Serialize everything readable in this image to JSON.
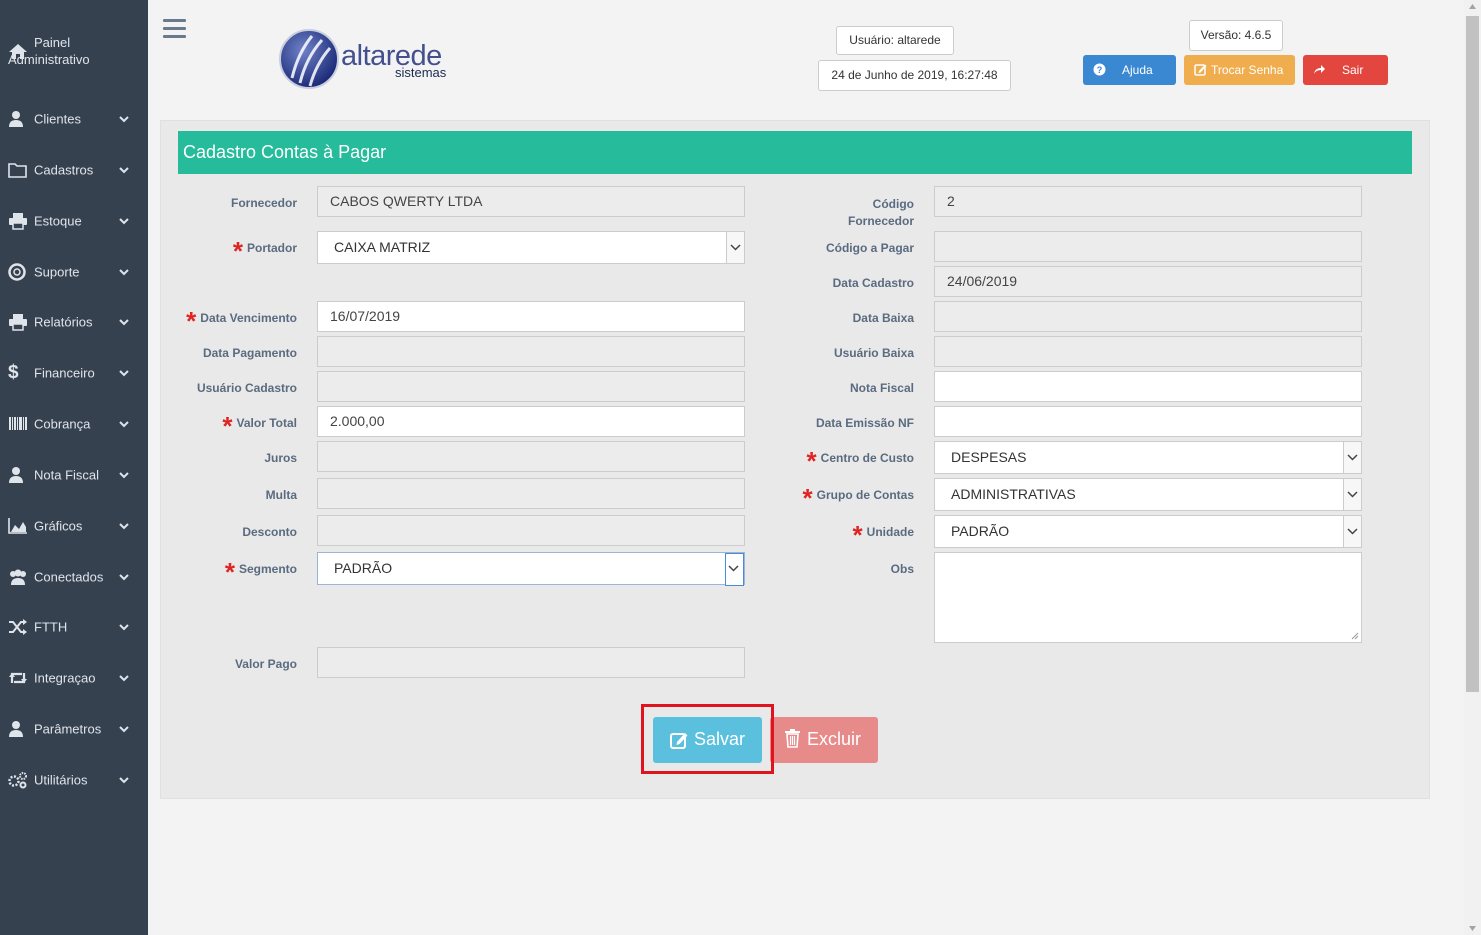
{
  "sidebar": {
    "items": [
      {
        "label": "Painel Administrativo",
        "icon": "home-icon"
      },
      {
        "label": "Clientes",
        "icon": "user-icon"
      },
      {
        "label": "Cadastros",
        "icon": "folder-icon"
      },
      {
        "label": "Estoque",
        "icon": "print-icon"
      },
      {
        "label": "Suporte",
        "icon": "lifebuoy-icon"
      },
      {
        "label": "Relatórios",
        "icon": "print-icon"
      },
      {
        "label": "Financeiro",
        "icon": "dollar-icon"
      },
      {
        "label": "Cobrança",
        "icon": "barcode-icon"
      },
      {
        "label": "Nota Fiscal",
        "icon": "user-icon"
      },
      {
        "label": "Gráficos",
        "icon": "area-chart-icon"
      },
      {
        "label": "Conectados",
        "icon": "users-icon"
      },
      {
        "label": "FTTH",
        "icon": "random-icon"
      },
      {
        "label": "Integraçao",
        "icon": "retweet-icon"
      },
      {
        "label": "Parâmetros",
        "icon": "user-icon"
      },
      {
        "label": "Utilitários",
        "icon": "cogs-icon"
      }
    ]
  },
  "header": {
    "logo_text": "altarede",
    "logo_sub": "sistemas",
    "user": "Usuário: altarede",
    "datetime": "24 de Junho de 2019, 16:27:48",
    "version": "Versão: 4.6.5",
    "help_label": "Ajuda",
    "change_password_label": "Trocar Senha",
    "exit_label": "Sair"
  },
  "form": {
    "title": "Cadastro Contas à Pagar",
    "left": {
      "fornecedor": {
        "label": "Fornecedor",
        "value": "CABOS QWERTY LTDA"
      },
      "portador": {
        "label": "Portador",
        "value": "CAIXA MATRIZ"
      },
      "data_vencimento": {
        "label": "Data Vencimento",
        "value": "16/07/2019"
      },
      "data_pagamento": {
        "label": "Data Pagamento",
        "value": ""
      },
      "usuario_cadastro": {
        "label": "Usuário Cadastro",
        "value": ""
      },
      "valor_total": {
        "label": "Valor Total",
        "value": "2.000,00"
      },
      "juros": {
        "label": "Juros",
        "value": ""
      },
      "multa": {
        "label": "Multa",
        "value": ""
      },
      "desconto": {
        "label": "Desconto",
        "value": ""
      },
      "segmento": {
        "label": "Segmento",
        "value": "PADRÃO"
      },
      "valor_pago": {
        "label": "Valor Pago",
        "value": ""
      }
    },
    "right": {
      "codigo_fornecedor": {
        "label_line1": "Código",
        "label_line2": "Fornecedor",
        "value": "2"
      },
      "codigo_pagar": {
        "label": "Código a Pagar",
        "value": ""
      },
      "data_cadastro": {
        "label": "Data Cadastro",
        "value": "24/06/2019"
      },
      "data_baixa": {
        "label": "Data Baixa",
        "value": ""
      },
      "usuario_baixa": {
        "label": "Usuário Baixa",
        "value": ""
      },
      "nota_fiscal": {
        "label": "Nota Fiscal",
        "value": ""
      },
      "data_emissao_nf": {
        "label": "Data Emissão NF",
        "value": ""
      },
      "centro_custo": {
        "label": "Centro de Custo",
        "value": "DESPESAS"
      },
      "grupo_contas": {
        "label": "Grupo de Contas",
        "value": "ADMINISTRATIVAS"
      },
      "unidade": {
        "label": "Unidade",
        "value": "PADRÃO"
      },
      "obs": {
        "label": "Obs",
        "value": ""
      }
    },
    "required_mark": "*",
    "save_label": "Salvar",
    "delete_label": "Excluir"
  },
  "colors": {
    "sidebar_bg": "#364150",
    "title_bar": "#25bb9b",
    "help_btn": "#3a87d2",
    "password_btn": "#f0ad4e",
    "exit_btn": "#e2463f",
    "save_btn": "#5bc0de",
    "delete_btn": "#e78a8a",
    "highlight": "#e0141e"
  }
}
